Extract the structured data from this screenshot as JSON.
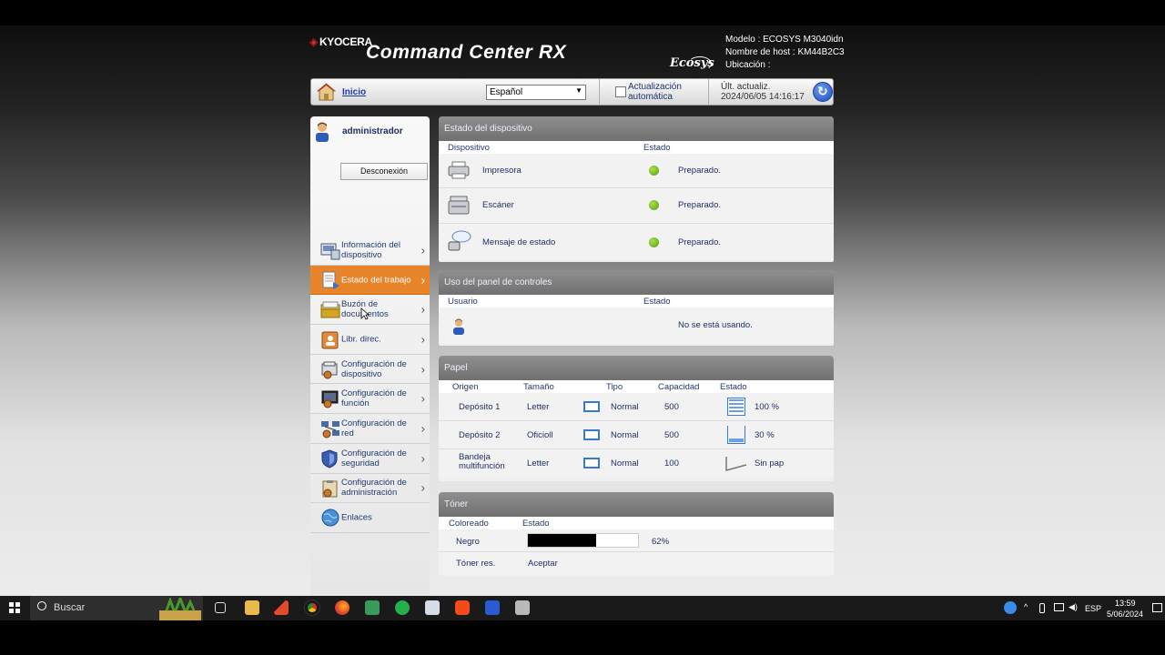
{
  "header": {
    "brand": "KYOCERA",
    "title": "Command Center RX",
    "ecosys": "Ecosys",
    "model": "Modelo : ECOSYS M3040idn",
    "host": "Nombre de host : KM44B2C3",
    "location": "Ubicación :"
  },
  "topbar": {
    "home_label": "Inicio",
    "language": "Español",
    "auto_update_line1": "Actualización",
    "auto_update_line2": "automática",
    "last_update_label": "Últ. actualiz.",
    "last_update_value": "2024/06/05 14:16:17"
  },
  "sidebar": {
    "user": "administrador",
    "logout": "Desconexión",
    "items": [
      {
        "label": "Información del dispositivo"
      },
      {
        "label": "Estado del trabajo"
      },
      {
        "label": "Buzón de documentos"
      },
      {
        "label": "Libr. direc."
      },
      {
        "label": "Configuración de dispositivo"
      },
      {
        "label": "Configuración de función"
      },
      {
        "label": "Configuración de red"
      },
      {
        "label": "Configuración de seguridad"
      },
      {
        "label": "Configuración de administración"
      },
      {
        "label": "Enlaces"
      }
    ]
  },
  "device_status": {
    "title": "Estado del dispositivo",
    "col_device": "Dispositivo",
    "col_status": "Estado",
    "rows": [
      {
        "device": "Impresora",
        "status": "Preparado."
      },
      {
        "device": "Escáner",
        "status": "Preparado."
      },
      {
        "device": "Mensaje de estado",
        "status": "Preparado."
      }
    ]
  },
  "panel_usage": {
    "title": "Uso del panel de controles",
    "col_user": "Usuario",
    "col_status": "Estado",
    "status": "No se está usando."
  },
  "paper": {
    "title": "Papel",
    "cols": [
      "Origen",
      "Tamaño",
      "Tipo",
      "Capacidad",
      "Estado"
    ],
    "rows": [
      {
        "source": "Depósito 1",
        "size": "Letter",
        "type": "Normal",
        "capacity": "500",
        "level": "100 %",
        "fill": 1.0
      },
      {
        "source": "Depósito 2",
        "size": "Oficioll",
        "type": "Normal",
        "capacity": "500",
        "level": "30 %",
        "fill": 0.3
      },
      {
        "source": "Bandeja multifunción",
        "size": "Letter",
        "type": "Normal",
        "capacity": "100",
        "level": "Sin pap",
        "fill": 0
      }
    ]
  },
  "toner": {
    "title": "Tóner",
    "col_color": "Coloreado",
    "col_status": "Estado",
    "black_label": "Negro",
    "black_percent": "62%",
    "black_fill": 0.62,
    "waste_label": "Tóner res.",
    "waste_status": "Aceptar"
  },
  "taskbar": {
    "search": "Buscar",
    "lang": "ESP",
    "time": "13:59",
    "date": "5/06/2024"
  }
}
